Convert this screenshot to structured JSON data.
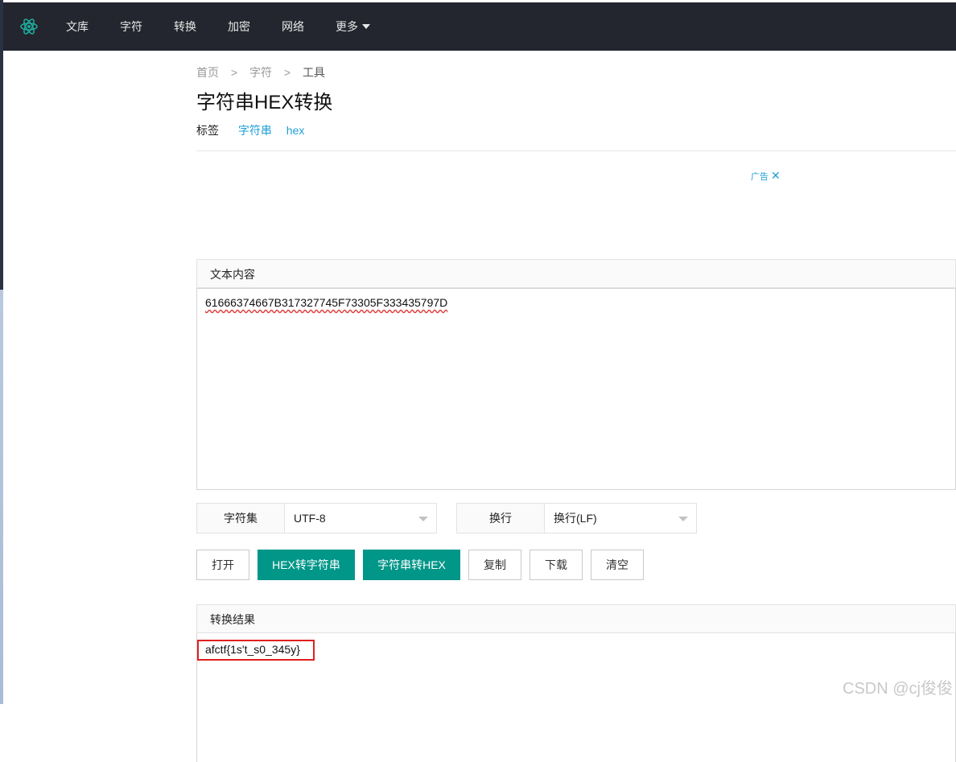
{
  "nav": {
    "items": [
      "文库",
      "字符",
      "转换",
      "加密",
      "网络"
    ],
    "more_label": "更多"
  },
  "breadcrumb": {
    "home": "首页",
    "category": "字符",
    "current": "工具",
    "separator": ">"
  },
  "page_title": "字符串HEX转换",
  "tags": {
    "label": "标签",
    "items": [
      "字符串",
      "hex"
    ]
  },
  "ad": {
    "label": "广告",
    "close": "✕"
  },
  "text_panel": {
    "title": "文本内容",
    "value": "61666374667B317327745F73305F333435797D"
  },
  "options": {
    "charset_label": "字符集",
    "charset_value": "UTF-8",
    "linebreak_label": "换行",
    "linebreak_value": "换行(LF)"
  },
  "buttons": {
    "open": "打开",
    "hex_to_string": "HEX转字符串",
    "string_to_hex": "字符串转HEX",
    "copy": "复制",
    "download": "下载",
    "clear": "清空"
  },
  "result_panel": {
    "title": "转换结果",
    "value": "afctf{1s't_s0_345y}"
  },
  "watermark": "CSDN @cj俊俊",
  "colors": {
    "nav_bg": "#23262e",
    "primary": "#009688",
    "link": "#1e9fd6",
    "highlight_border": "#e02020"
  }
}
